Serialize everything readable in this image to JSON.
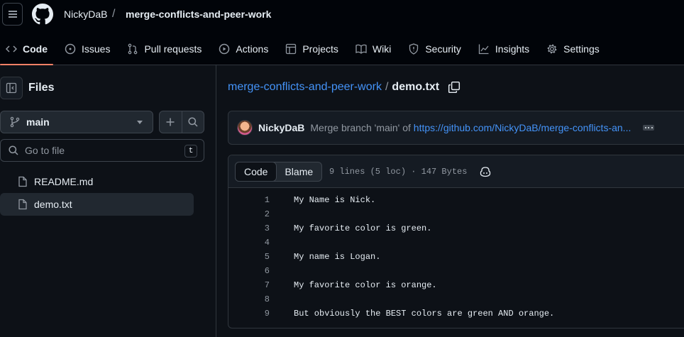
{
  "header": {
    "owner": "NickyDaB",
    "separator": "/",
    "repo": "merge-conflicts-and-peer-work"
  },
  "nav": [
    {
      "label": "Code",
      "icon": "code-icon"
    },
    {
      "label": "Issues",
      "icon": "issue-icon"
    },
    {
      "label": "Pull requests",
      "icon": "pull-request-icon"
    },
    {
      "label": "Actions",
      "icon": "play-icon"
    },
    {
      "label": "Projects",
      "icon": "table-icon"
    },
    {
      "label": "Wiki",
      "icon": "book-icon"
    },
    {
      "label": "Security",
      "icon": "shield-icon"
    },
    {
      "label": "Insights",
      "icon": "graph-icon"
    },
    {
      "label": "Settings",
      "icon": "gear-icon"
    }
  ],
  "sidebar": {
    "title": "Files",
    "branch": "main",
    "search_placeholder": "Go to file",
    "search_shortcut": "t",
    "files": [
      {
        "name": "README.md"
      },
      {
        "name": "demo.txt"
      }
    ]
  },
  "breadcrumb": {
    "repo": "merge-conflicts-and-peer-work",
    "separator": "/",
    "file": "demo.txt"
  },
  "commit": {
    "author": "NickyDaB",
    "message_prefix": "Merge branch 'main' of",
    "link_text": "https://github.com/NickyDaB/merge-conflicts-an..."
  },
  "viewer": {
    "tab_code": "Code",
    "tab_blame": "Blame",
    "meta": "9 lines (5 loc) · 147 Bytes"
  },
  "lines": [
    {
      "n": "1",
      "t": "My Name is Nick."
    },
    {
      "n": "2",
      "t": ""
    },
    {
      "n": "3",
      "t": "My favorite color is green."
    },
    {
      "n": "4",
      "t": ""
    },
    {
      "n": "5",
      "t": "My name is Logan."
    },
    {
      "n": "6",
      "t": ""
    },
    {
      "n": "7",
      "t": "My favorite color is orange."
    },
    {
      "n": "8",
      "t": ""
    },
    {
      "n": "9",
      "t": "But obviously the BEST colors are green AND orange."
    }
  ]
}
